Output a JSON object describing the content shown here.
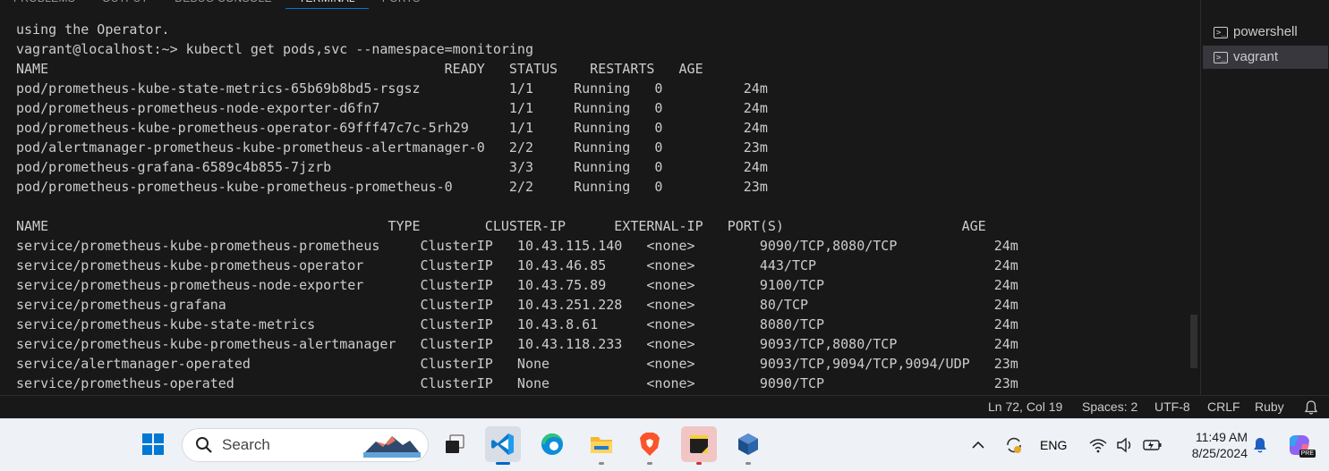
{
  "panel": {
    "tabs": [
      {
        "label": "PROBLEMS"
      },
      {
        "label": "OUTPUT"
      },
      {
        "label": "DEBUG CONSOLE"
      },
      {
        "label": "TERMINAL"
      },
      {
        "label": "PORTS"
      }
    ],
    "active_tab": "TERMINAL",
    "actions": [
      "+",
      "⌄",
      "···",
      "∧",
      "✕"
    ]
  },
  "terminal": {
    "lines": [
      "using the Operator.",
      "vagrant@localhost:~> kubectl get pods,svc --namespace=monitoring",
      "NAME                                                 READY   STATUS    RESTARTS   AGE",
      "pod/prometheus-kube-state-metrics-65b69b8bd5-rsgsz           1/1     Running   0          24m",
      "pod/prometheus-prometheus-node-exporter-d6fn7                1/1     Running   0          24m",
      "pod/prometheus-kube-prometheus-operator-69fff47c7c-5rh29     1/1     Running   0          24m",
      "pod/alertmanager-prometheus-kube-prometheus-alertmanager-0   2/2     Running   0          23m",
      "pod/prometheus-grafana-6589c4b855-7jzrb                      3/3     Running   0          24m",
      "pod/prometheus-prometheus-kube-prometheus-prometheus-0       2/2     Running   0          23m",
      "",
      "NAME                                          TYPE        CLUSTER-IP      EXTERNAL-IP   PORT(S)                      AGE",
      "service/prometheus-kube-prometheus-prometheus     ClusterIP   10.43.115.140   <none>        9090/TCP,8080/TCP            24m",
      "service/prometheus-kube-prometheus-operator       ClusterIP   10.43.46.85     <none>        443/TCP                      24m",
      "service/prometheus-prometheus-node-exporter       ClusterIP   10.43.75.89     <none>        9100/TCP                     24m",
      "service/prometheus-grafana                        ClusterIP   10.43.251.228   <none>        80/TCP                       24m",
      "service/prometheus-kube-state-metrics             ClusterIP   10.43.8.61      <none>        8080/TCP                     24m",
      "service/prometheus-kube-prometheus-alertmanager   ClusterIP   10.43.118.233   <none>        9093/TCP,8080/TCP            24m",
      "service/alertmanager-operated                     ClusterIP   None            <none>        9093/TCP,9094/TCP,9094/UDP   23m",
      "service/prometheus-operated                       ClusterIP   None            <none>        9090/TCP                     23m"
    ]
  },
  "terminal_list": {
    "items": [
      {
        "label": "powershell",
        "icon": "terminal-icon",
        "active": false
      },
      {
        "label": "vagrant",
        "icon": "terminal-icon",
        "active": true
      }
    ]
  },
  "status_bar": {
    "position": "Ln 72, Col 19",
    "spaces": "Spaces: 2",
    "encoding": "UTF-8",
    "eol": "CRLF",
    "language": "Ruby",
    "bell_icon": "bell-icon"
  },
  "taskbar": {
    "search_placeholder": "Search",
    "apps": [
      "start-icon",
      "task-view-icon",
      "vscode-icon",
      "edge-icon",
      "file-explorer-icon",
      "brave-icon",
      "sticky-notes-icon",
      "virtualbox-icon"
    ],
    "tray": {
      "language": "ENG",
      "time": "11:49 AM",
      "date": "8/25/2024",
      "copilot_badge": "PRE"
    }
  },
  "colors": {
    "terminal_bg": "#181818",
    "terminal_fg": "#cccccc",
    "accent": "#0078d4",
    "taskbar_bg": "#eef1f6"
  }
}
